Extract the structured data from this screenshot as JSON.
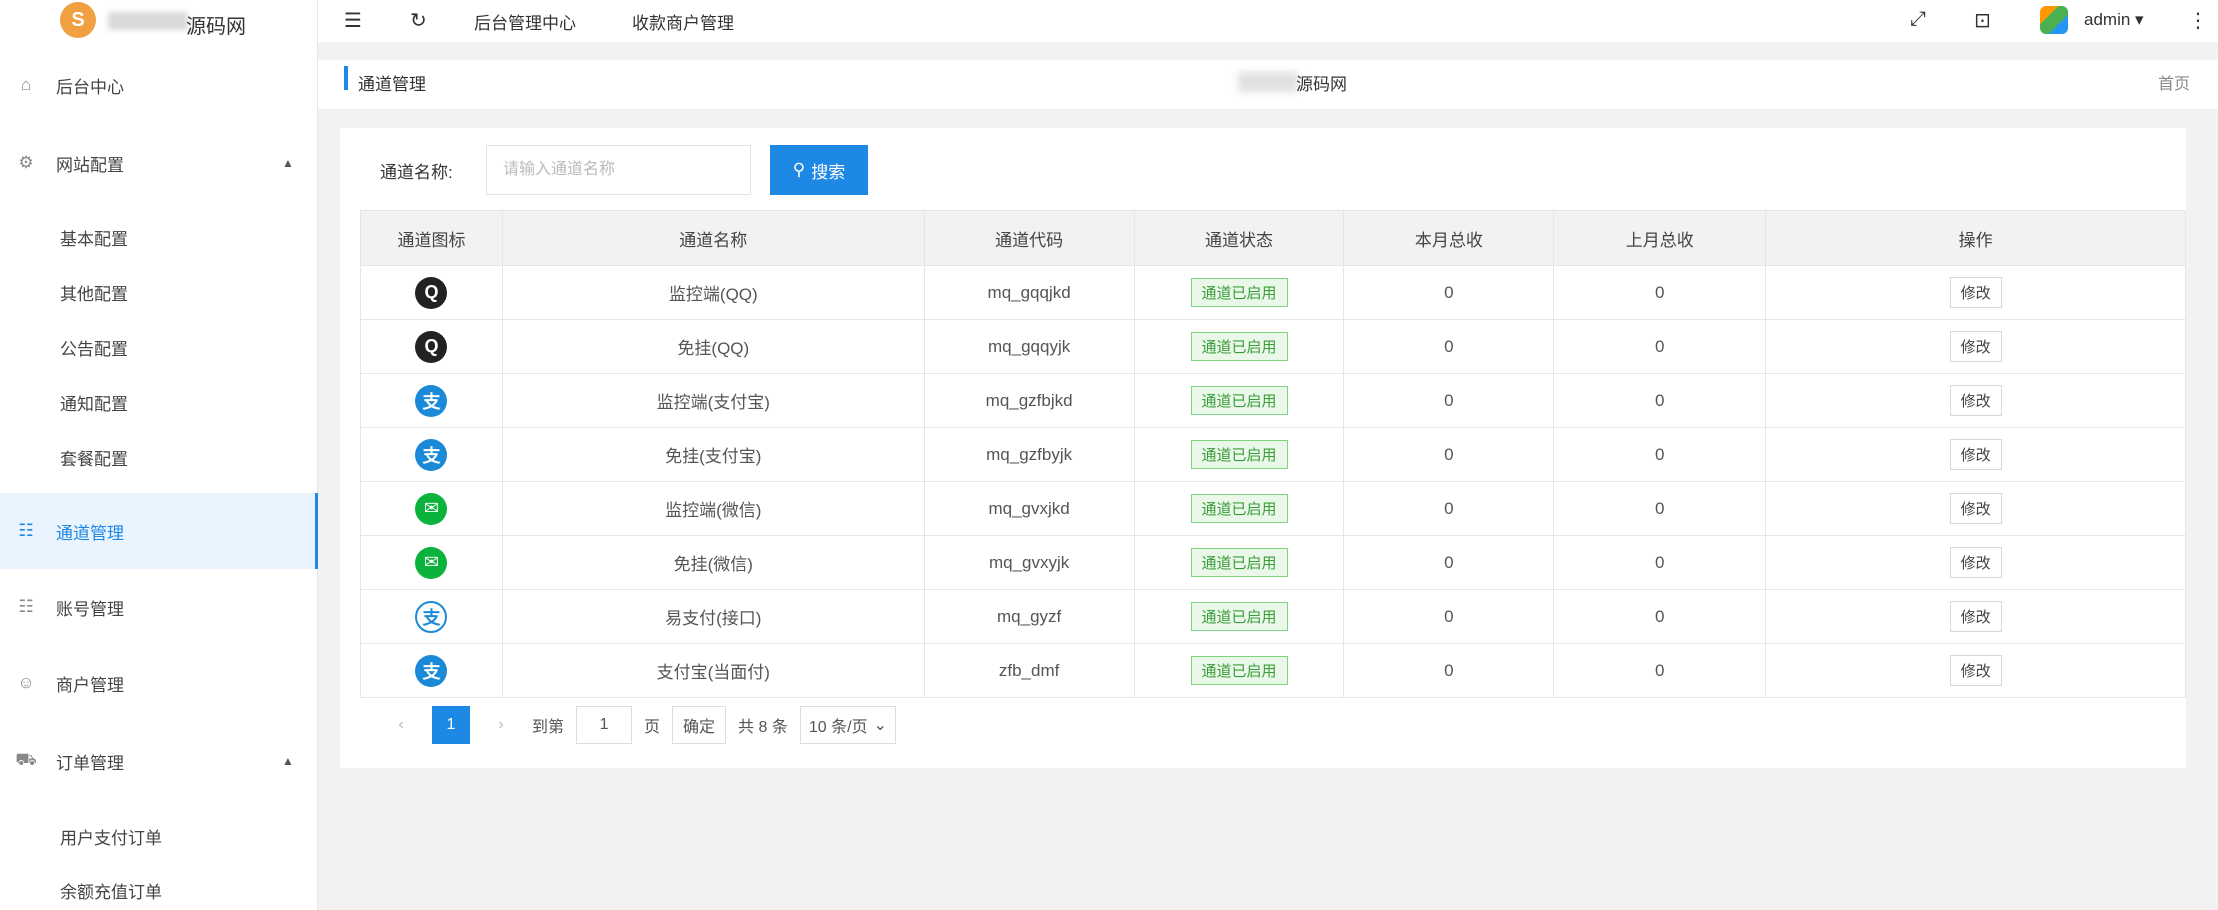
{
  "brand": {
    "logo_letter": "S",
    "name": "源码网"
  },
  "topbar": {
    "items": [
      "后台管理中心",
      "收款商户管理"
    ],
    "user": "admin ▾"
  },
  "tabbar": {
    "title": "通道管理",
    "center_text": "源码网",
    "home": "首页"
  },
  "sidebar": {
    "items": [
      {
        "label": "后台中心",
        "icon": "home-icon"
      },
      {
        "label": "网站配置",
        "icon": "gear-icon",
        "expanded": true
      },
      {
        "label": "通道管理",
        "icon": "channel-icon",
        "active": true
      },
      {
        "label": "账号管理",
        "icon": "account-icon"
      },
      {
        "label": "商户管理",
        "icon": "user-icon"
      },
      {
        "label": "订单管理",
        "icon": "cart-icon",
        "expanded": true
      }
    ],
    "site_sub": [
      "基本配置",
      "其他配置",
      "公告配置",
      "通知配置",
      "套餐配置"
    ],
    "order_sub": [
      "用户支付订单",
      "余额充值订单"
    ]
  },
  "search": {
    "label": "通道名称:",
    "placeholder": "请输入通道名称",
    "button": "搜索"
  },
  "table": {
    "headers": [
      "通道图标",
      "通道名称",
      "通道代码",
      "通道状态",
      "本月总收",
      "上月总收",
      "操作"
    ],
    "rows": [
      {
        "icon": "qq",
        "name": "监控端(QQ)",
        "code": "mq_gqqjkd",
        "status": "通道已启用",
        "month": "0",
        "last_month": "0",
        "action": "修改"
      },
      {
        "icon": "qq",
        "name": "免挂(QQ)",
        "code": "mq_gqqyjk",
        "status": "通道已启用",
        "month": "0",
        "last_month": "0",
        "action": "修改"
      },
      {
        "icon": "ali",
        "name": "监控端(支付宝)",
        "code": "mq_gzfbjkd",
        "status": "通道已启用",
        "month": "0",
        "last_month": "0",
        "action": "修改"
      },
      {
        "icon": "ali",
        "name": "免挂(支付宝)",
        "code": "mq_gzfbyjk",
        "status": "通道已启用",
        "month": "0",
        "last_month": "0",
        "action": "修改"
      },
      {
        "icon": "wx",
        "name": "监控端(微信)",
        "code": "mq_gvxjkd",
        "status": "通道已启用",
        "month": "0",
        "last_month": "0",
        "action": "修改"
      },
      {
        "icon": "wx",
        "name": "免挂(微信)",
        "code": "mq_gvxyjk",
        "status": "通道已启用",
        "month": "0",
        "last_month": "0",
        "action": "修改"
      },
      {
        "icon": "epay",
        "name": "易支付(接口)",
        "code": "mq_gyzf",
        "status": "通道已启用",
        "month": "0",
        "last_month": "0",
        "action": "修改"
      },
      {
        "icon": "ali",
        "name": "支付宝(当面付)",
        "code": "zfb_dmf",
        "status": "通道已启用",
        "month": "0",
        "last_month": "0",
        "action": "修改"
      }
    ]
  },
  "pagination": {
    "current": "1",
    "goto_label": "到第",
    "goto_value": "1",
    "page_unit": "页",
    "confirm": "确定",
    "total": "共 8 条",
    "per_page": "10 条/页"
  },
  "colors": {
    "primary": "#1e88e5",
    "status_green": "#3a9c3a",
    "sidebar_bg": "#ffffff",
    "content_bg": "#f2f2f2"
  }
}
